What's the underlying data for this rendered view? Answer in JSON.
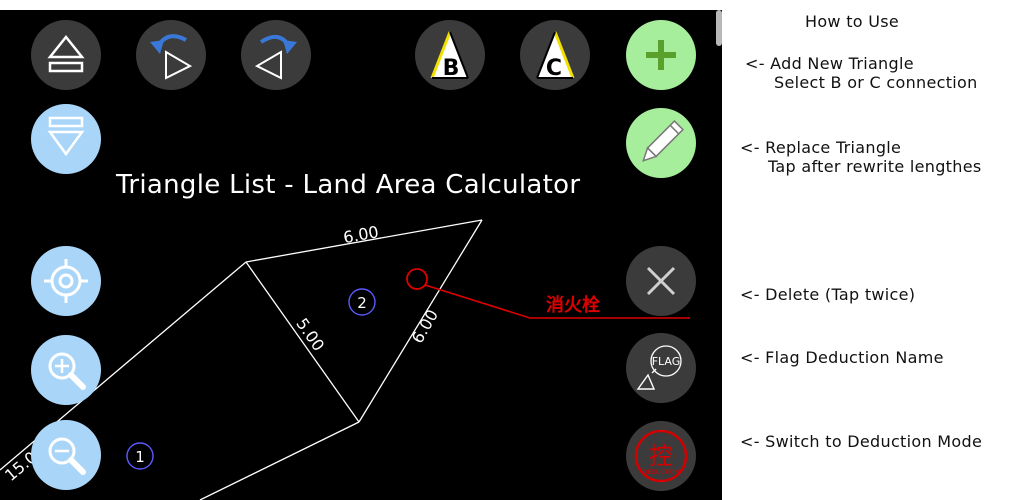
{
  "canvas": {
    "title": "Triangle List - Land Area Calculator",
    "edge_labels": {
      "top": "6.00",
      "shared": "5.00",
      "right": "6.00",
      "left": "15.0"
    },
    "triangle_numbers": {
      "first": "1",
      "second": "2"
    },
    "deduction_text": "消火栓",
    "colors": {
      "background": "#000000",
      "lines": "#ffffff",
      "marker": "#dd0000",
      "number_circle": "#5a5aff"
    }
  },
  "toolbar": {
    "eject_up": {
      "icon": "eject-up-icon"
    },
    "eject_down": {
      "icon": "eject-down-icon"
    },
    "rotate_left": {
      "icon": "rotate-ccw-triangle-icon"
    },
    "rotate_right": {
      "icon": "rotate-cw-triangle-icon"
    },
    "connect_b": {
      "icon": "triangle-b-icon",
      "label": "B"
    },
    "connect_c": {
      "icon": "triangle-c-icon",
      "label": "C"
    },
    "add": {
      "icon": "plus-icon"
    },
    "replace": {
      "icon": "pencil-icon"
    },
    "delete": {
      "icon": "close-icon"
    },
    "flag": {
      "icon": "flag-icon",
      "label": "FLAG"
    },
    "deduction": {
      "icon": "deduction-stamp-icon",
      "glyph": "控",
      "small_text": "DEDUCTION"
    },
    "locate": {
      "icon": "crosshair-icon"
    },
    "zoom_in": {
      "icon": "zoom-in-icon"
    },
    "zoom_out": {
      "icon": "zoom-out-icon"
    }
  },
  "help": {
    "heading": "How to Use",
    "add": {
      "line1": "<- Add New Triangle",
      "line2": "Select B or C connection"
    },
    "replace": {
      "line1": "<- Replace Triangle",
      "line2": "Tap after rewrite lengthes"
    },
    "delete": "<- Delete (Tap twice)",
    "flag": "<- Flag Deduction Name",
    "deduction": "<- Switch to Deduction Mode"
  }
}
